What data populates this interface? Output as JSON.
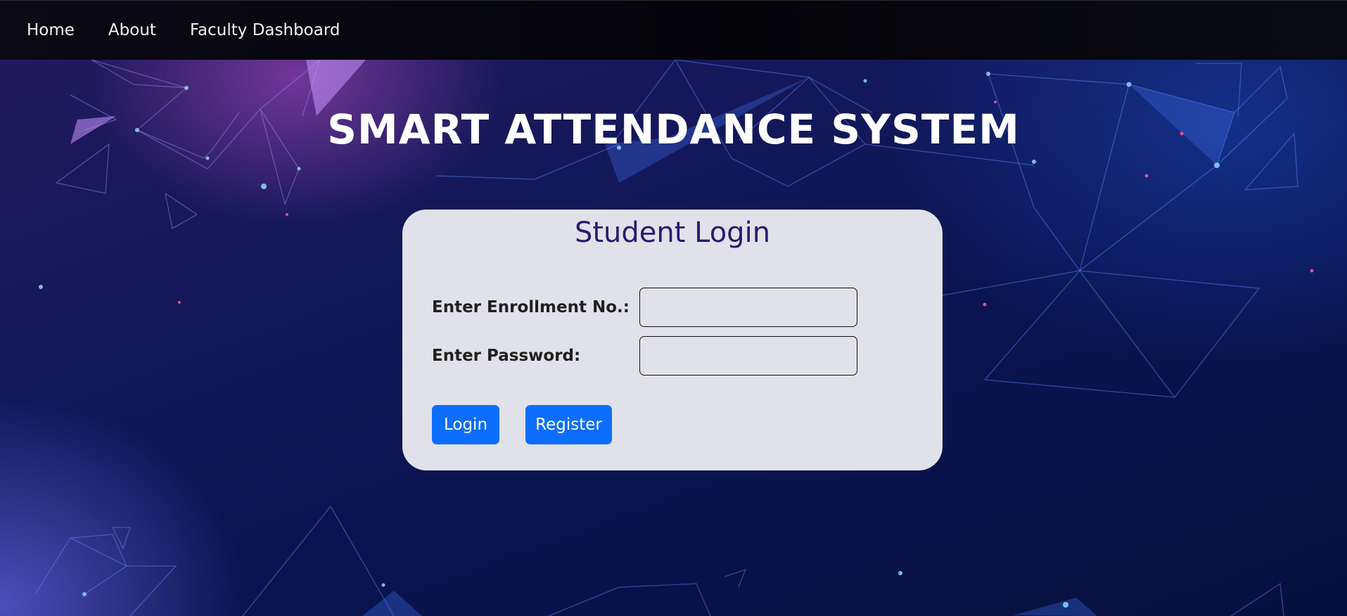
{
  "nav": {
    "items": [
      {
        "label": "Home"
      },
      {
        "label": "About"
      },
      {
        "label": "Faculty Dashboard"
      }
    ]
  },
  "page": {
    "title": "SMART ATTENDANCE SYSTEM"
  },
  "login_form": {
    "heading": "Student Login",
    "enrollment_label": "Enter Enrollment No.:",
    "enrollment_value": "",
    "password_label": "Enter Password:",
    "password_value": "",
    "login_button": "Login",
    "register_button": "Register"
  },
  "colors": {
    "nav_background": "#040409",
    "card_background": "#e8e8ee",
    "heading_color": "#2a1a6e",
    "button_primary": "#0d6efd"
  }
}
